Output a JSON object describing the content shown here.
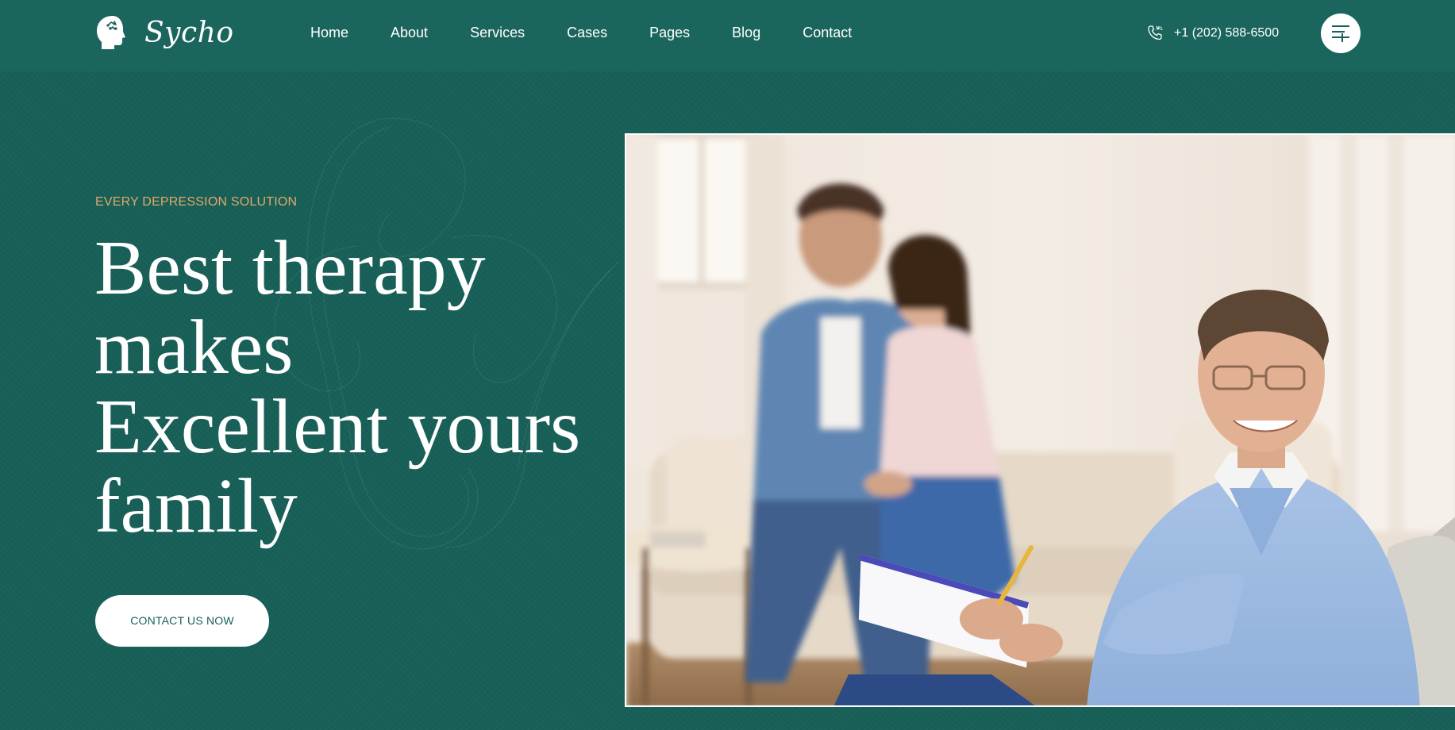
{
  "brand": {
    "name": "Sycho"
  },
  "nav": {
    "items": [
      {
        "label": "Home"
      },
      {
        "label": "About"
      },
      {
        "label": "Services"
      },
      {
        "label": "Cases"
      },
      {
        "label": "Pages"
      },
      {
        "label": "Blog"
      },
      {
        "label": "Contact"
      }
    ]
  },
  "contact": {
    "phone": "+1 (202) 588-6500",
    "phone_icon": "phone-icon"
  },
  "menu": {
    "icon": "menu-icon"
  },
  "hero": {
    "eyebrow": "EVERY DEPRESSION SOLUTION",
    "headline_lines": [
      "Best therapy",
      "makes",
      "Excellent yours",
      "family"
    ],
    "cta_label": "CONTACT US NOW"
  },
  "colors": {
    "background": "#175f57",
    "accent": "#e2a86a",
    "text": "#ffffff"
  }
}
